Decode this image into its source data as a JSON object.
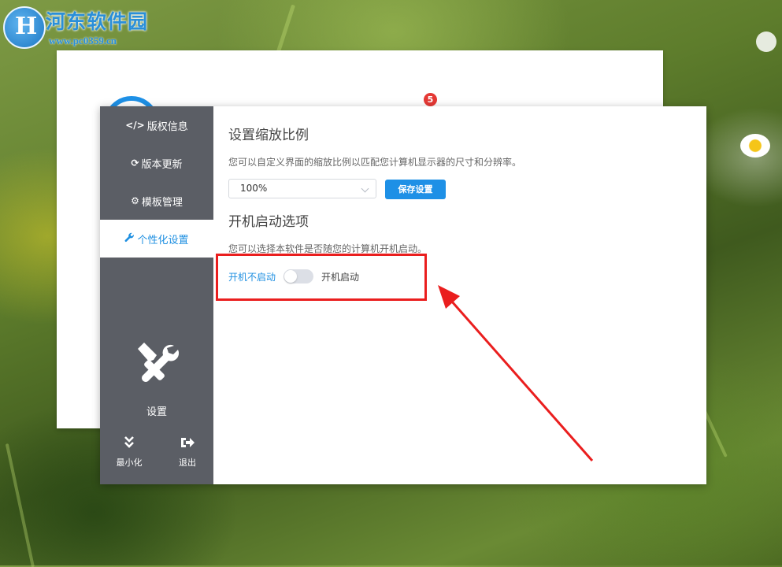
{
  "watermark": {
    "title": "河东软件园",
    "url": "www.pc0359.cn"
  },
  "background_window": {
    "badge_count": "5"
  },
  "sidebar": {
    "items": [
      {
        "label": "版权信息",
        "icon": "code-icon"
      },
      {
        "label": "版本更新",
        "icon": "refresh-icon"
      },
      {
        "label": "模板管理",
        "icon": "gear-icon"
      },
      {
        "label": "个性化设置",
        "icon": "wrench-icon",
        "active": true
      }
    ],
    "section_title": "设置",
    "minimize_label": "最小化",
    "exit_label": "退出"
  },
  "main": {
    "zoom_title": "设置缩放比例",
    "zoom_desc": "您可以自定义界面的缩放比例以匹配您计算机显示器的尺寸和分辨率。",
    "zoom_value": "100%",
    "save_label": "保存设置",
    "startup_title": "开机启动选项",
    "startup_desc": "您可以选择本软件是否随您的计算机开机启动。",
    "startup_off_label": "开机不启动",
    "startup_on_label": "开机启动",
    "startup_enabled": false
  },
  "colors": {
    "accent": "#1e90e6",
    "sidebar_bg": "#5b5e65",
    "highlight": "#ea1e1e",
    "badge": "#e53935"
  }
}
